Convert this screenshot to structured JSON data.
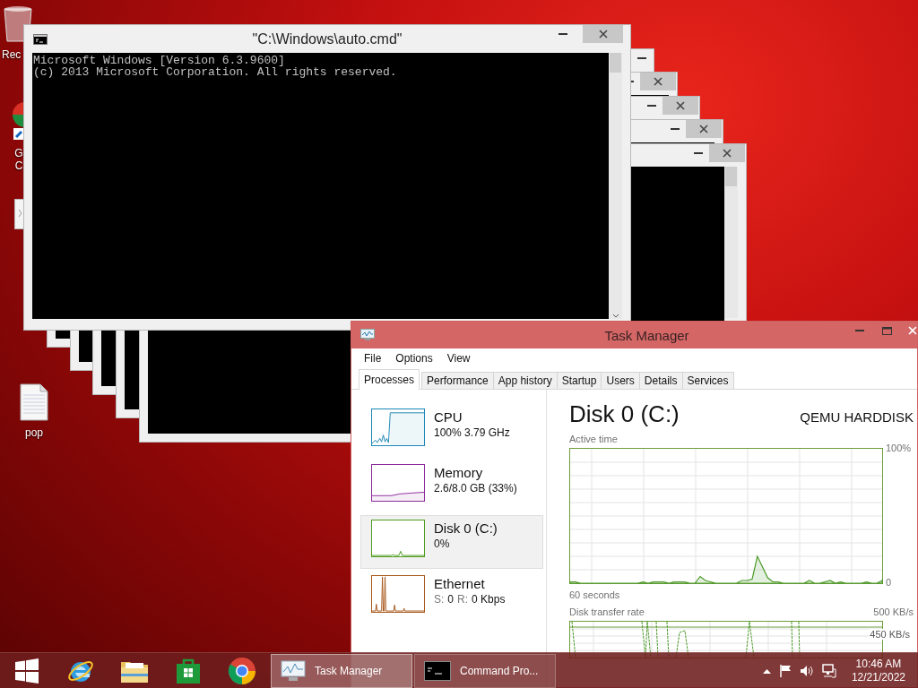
{
  "desktop_icons": [
    {
      "kind": "recycle-bin",
      "labels": [
        "Rec"
      ]
    },
    {
      "kind": "shortcut",
      "labels": [
        "G",
        "C"
      ]
    },
    {
      "kind": "document"
    },
    {
      "kind": "text-file",
      "labels": [
        "pop"
      ]
    }
  ],
  "stacked_windows": [
    {
      "kind": "console"
    },
    {
      "kind": "console"
    },
    {
      "kind": "console"
    },
    {
      "kind": "console"
    },
    {
      "kind": "console"
    }
  ],
  "console": {
    "title": "\"C:\\Windows\\auto.cmd\"",
    "lines": [
      "Microsoft Windows [Version 6.3.9600]",
      "(c) 2013 Microsoft Corporation. All rights reserved."
    ]
  },
  "task_manager": {
    "title": "Task Manager",
    "menu": [
      "File",
      "Options",
      "View"
    ],
    "tabs": [
      {
        "label": "Processes",
        "selected": true
      },
      {
        "label": "Performance",
        "selected": false
      },
      {
        "label": "App history",
        "selected": false
      },
      {
        "label": "Startup",
        "selected": false
      },
      {
        "label": "Users",
        "selected": false
      },
      {
        "label": "Details",
        "selected": false
      },
      {
        "label": "Services",
        "selected": false
      }
    ],
    "resources": [
      {
        "kind": "cpu",
        "name": "CPU",
        "detail": "100% 3.79 GHz",
        "color": "#1b86b5",
        "selected": false
      },
      {
        "kind": "memory",
        "name": "Memory",
        "detail": "2.6/8.0 GB (33%)",
        "color": "#8b2b9b",
        "selected": false
      },
      {
        "kind": "disk",
        "name": "Disk 0 (C:)",
        "detail": "0%",
        "color": "#4f9b1f",
        "selected": true
      },
      {
        "kind": "network",
        "name": "Ethernet",
        "stats": [
          {
            "label": "S:",
            "value": "0"
          },
          {
            "label": "R:",
            "value": "0 Kbps"
          }
        ],
        "color": "#a7581b",
        "selected": false
      }
    ],
    "detail": {
      "title": "Disk 0 (C:)",
      "model": "QEMU HARDDISK",
      "active_time": {
        "chart_data": {
          "type": "area",
          "title": "Active time",
          "xlabel": "60 seconds",
          "grid": true,
          "ylim": [
            0,
            100
          ],
          "yticks": [
            {
              "value": 0,
              "label": "0"
            },
            {
              "value": 100,
              "label": "100%"
            }
          ],
          "series": [
            {
              "color": "#4c9a2a",
              "values": [
                1,
                1,
                0,
                0,
                0,
                0,
                0,
                0,
                0,
                0,
                0,
                0,
                0,
                0,
                1,
                0,
                1,
                1,
                1,
                0,
                1,
                1,
                1,
                0,
                0,
                5,
                2,
                1,
                0,
                0,
                0,
                0,
                0,
                2,
                2,
                3,
                20,
                12,
                4,
                1,
                1,
                0,
                0,
                0,
                0,
                0,
                2,
                0,
                0,
                1,
                2,
                0,
                1,
                0,
                0,
                0,
                0,
                1,
                0,
                0,
                2
              ]
            }
          ]
        }
      },
      "transfer_rate": {
        "title": "Disk transfer rate",
        "max": "500 KB/s",
        "mark": "450 KB/s"
      }
    }
  },
  "taskbar": {
    "pinned": [
      {
        "kind": "start"
      },
      {
        "kind": "browser-e"
      },
      {
        "kind": "folder"
      },
      {
        "kind": "store"
      },
      {
        "kind": "browser-round"
      }
    ],
    "buttons": [
      {
        "kind": "task-manager",
        "label": "Task Manager",
        "selected": true
      },
      {
        "kind": "console",
        "label": "Command Pro...",
        "selected": false
      }
    ],
    "clock": {
      "time": "10:46 AM",
      "date": "12/21/2022"
    }
  }
}
